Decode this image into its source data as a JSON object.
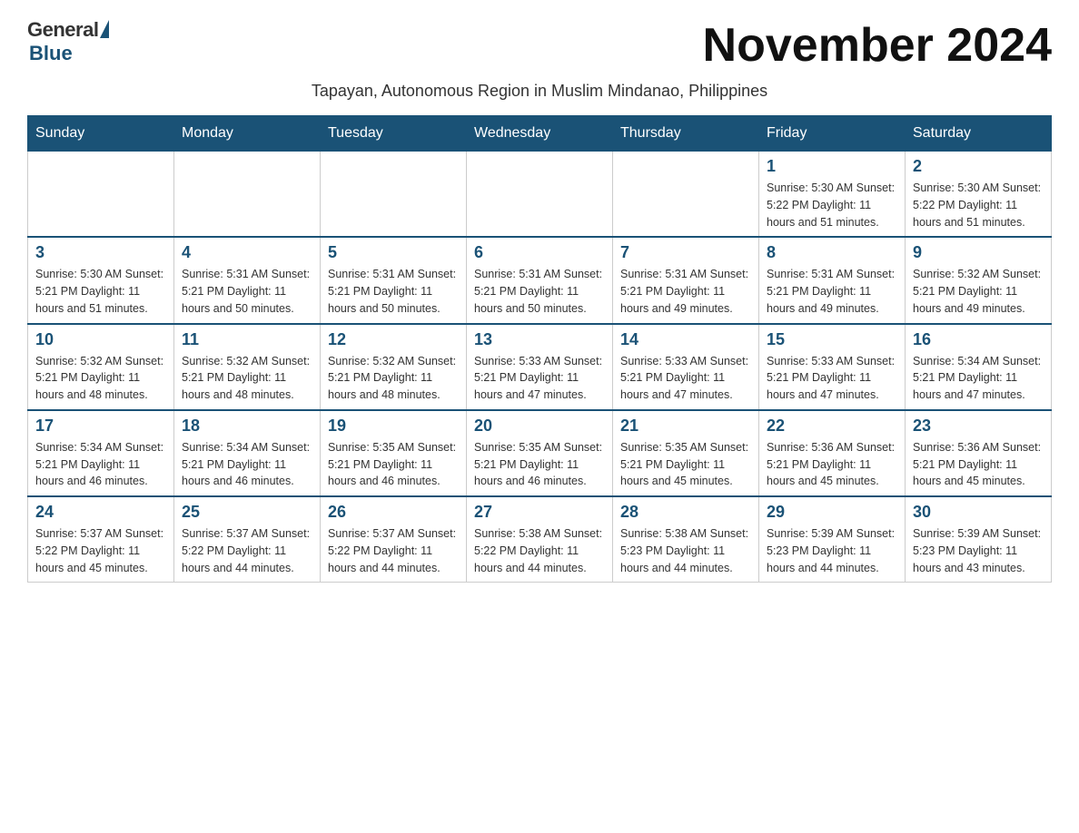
{
  "header": {
    "logo_general": "General",
    "logo_blue": "Blue",
    "title": "November 2024",
    "subtitle": "Tapayan, Autonomous Region in Muslim Mindanao, Philippines"
  },
  "days_of_week": [
    "Sunday",
    "Monday",
    "Tuesday",
    "Wednesday",
    "Thursday",
    "Friday",
    "Saturday"
  ],
  "weeks": [
    [
      {
        "day": "",
        "info": ""
      },
      {
        "day": "",
        "info": ""
      },
      {
        "day": "",
        "info": ""
      },
      {
        "day": "",
        "info": ""
      },
      {
        "day": "",
        "info": ""
      },
      {
        "day": "1",
        "info": "Sunrise: 5:30 AM\nSunset: 5:22 PM\nDaylight: 11 hours and 51 minutes."
      },
      {
        "day": "2",
        "info": "Sunrise: 5:30 AM\nSunset: 5:22 PM\nDaylight: 11 hours and 51 minutes."
      }
    ],
    [
      {
        "day": "3",
        "info": "Sunrise: 5:30 AM\nSunset: 5:21 PM\nDaylight: 11 hours and 51 minutes."
      },
      {
        "day": "4",
        "info": "Sunrise: 5:31 AM\nSunset: 5:21 PM\nDaylight: 11 hours and 50 minutes."
      },
      {
        "day": "5",
        "info": "Sunrise: 5:31 AM\nSunset: 5:21 PM\nDaylight: 11 hours and 50 minutes."
      },
      {
        "day": "6",
        "info": "Sunrise: 5:31 AM\nSunset: 5:21 PM\nDaylight: 11 hours and 50 minutes."
      },
      {
        "day": "7",
        "info": "Sunrise: 5:31 AM\nSunset: 5:21 PM\nDaylight: 11 hours and 49 minutes."
      },
      {
        "day": "8",
        "info": "Sunrise: 5:31 AM\nSunset: 5:21 PM\nDaylight: 11 hours and 49 minutes."
      },
      {
        "day": "9",
        "info": "Sunrise: 5:32 AM\nSunset: 5:21 PM\nDaylight: 11 hours and 49 minutes."
      }
    ],
    [
      {
        "day": "10",
        "info": "Sunrise: 5:32 AM\nSunset: 5:21 PM\nDaylight: 11 hours and 48 minutes."
      },
      {
        "day": "11",
        "info": "Sunrise: 5:32 AM\nSunset: 5:21 PM\nDaylight: 11 hours and 48 minutes."
      },
      {
        "day": "12",
        "info": "Sunrise: 5:32 AM\nSunset: 5:21 PM\nDaylight: 11 hours and 48 minutes."
      },
      {
        "day": "13",
        "info": "Sunrise: 5:33 AM\nSunset: 5:21 PM\nDaylight: 11 hours and 47 minutes."
      },
      {
        "day": "14",
        "info": "Sunrise: 5:33 AM\nSunset: 5:21 PM\nDaylight: 11 hours and 47 minutes."
      },
      {
        "day": "15",
        "info": "Sunrise: 5:33 AM\nSunset: 5:21 PM\nDaylight: 11 hours and 47 minutes."
      },
      {
        "day": "16",
        "info": "Sunrise: 5:34 AM\nSunset: 5:21 PM\nDaylight: 11 hours and 47 minutes."
      }
    ],
    [
      {
        "day": "17",
        "info": "Sunrise: 5:34 AM\nSunset: 5:21 PM\nDaylight: 11 hours and 46 minutes."
      },
      {
        "day": "18",
        "info": "Sunrise: 5:34 AM\nSunset: 5:21 PM\nDaylight: 11 hours and 46 minutes."
      },
      {
        "day": "19",
        "info": "Sunrise: 5:35 AM\nSunset: 5:21 PM\nDaylight: 11 hours and 46 minutes."
      },
      {
        "day": "20",
        "info": "Sunrise: 5:35 AM\nSunset: 5:21 PM\nDaylight: 11 hours and 46 minutes."
      },
      {
        "day": "21",
        "info": "Sunrise: 5:35 AM\nSunset: 5:21 PM\nDaylight: 11 hours and 45 minutes."
      },
      {
        "day": "22",
        "info": "Sunrise: 5:36 AM\nSunset: 5:21 PM\nDaylight: 11 hours and 45 minutes."
      },
      {
        "day": "23",
        "info": "Sunrise: 5:36 AM\nSunset: 5:21 PM\nDaylight: 11 hours and 45 minutes."
      }
    ],
    [
      {
        "day": "24",
        "info": "Sunrise: 5:37 AM\nSunset: 5:22 PM\nDaylight: 11 hours and 45 minutes."
      },
      {
        "day": "25",
        "info": "Sunrise: 5:37 AM\nSunset: 5:22 PM\nDaylight: 11 hours and 44 minutes."
      },
      {
        "day": "26",
        "info": "Sunrise: 5:37 AM\nSunset: 5:22 PM\nDaylight: 11 hours and 44 minutes."
      },
      {
        "day": "27",
        "info": "Sunrise: 5:38 AM\nSunset: 5:22 PM\nDaylight: 11 hours and 44 minutes."
      },
      {
        "day": "28",
        "info": "Sunrise: 5:38 AM\nSunset: 5:23 PM\nDaylight: 11 hours and 44 minutes."
      },
      {
        "day": "29",
        "info": "Sunrise: 5:39 AM\nSunset: 5:23 PM\nDaylight: 11 hours and 44 minutes."
      },
      {
        "day": "30",
        "info": "Sunrise: 5:39 AM\nSunset: 5:23 PM\nDaylight: 11 hours and 43 minutes."
      }
    ]
  ]
}
